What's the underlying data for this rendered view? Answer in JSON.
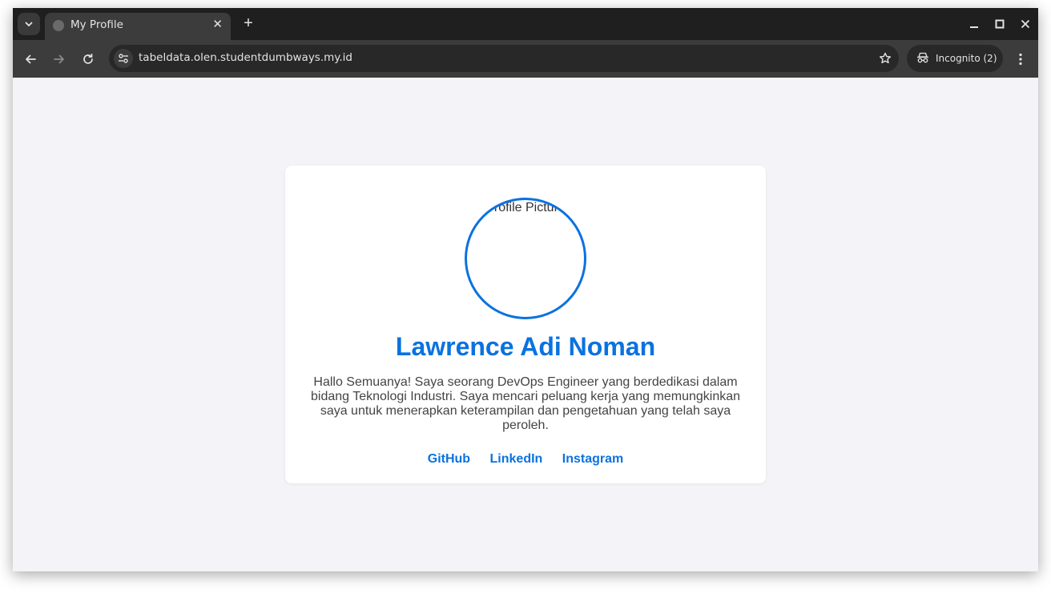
{
  "browser": {
    "tab_title": "My Profile",
    "url": "tabeldata.olen.studentdumbways.my.id",
    "incognito_label": "Incognito (2)"
  },
  "profile": {
    "avatar_alt": "Profile Picture",
    "name": "Lawrence Adi Noman",
    "bio": "Hallo Semuanya! Saya seorang DevOps Engineer yang berdedikasi dalam bidang Teknologi Industri. Saya mencari peluang kerja yang memungkinkan saya untuk menerapkan keterampilan dan pengetahuan yang telah saya peroleh.",
    "links": [
      {
        "label": "GitHub"
      },
      {
        "label": "LinkedIn"
      },
      {
        "label": "Instagram"
      }
    ]
  },
  "colors": {
    "accent": "#0a72e0",
    "page_bg": "#f3f3f8",
    "chrome_dark": "#1f1f1f"
  }
}
